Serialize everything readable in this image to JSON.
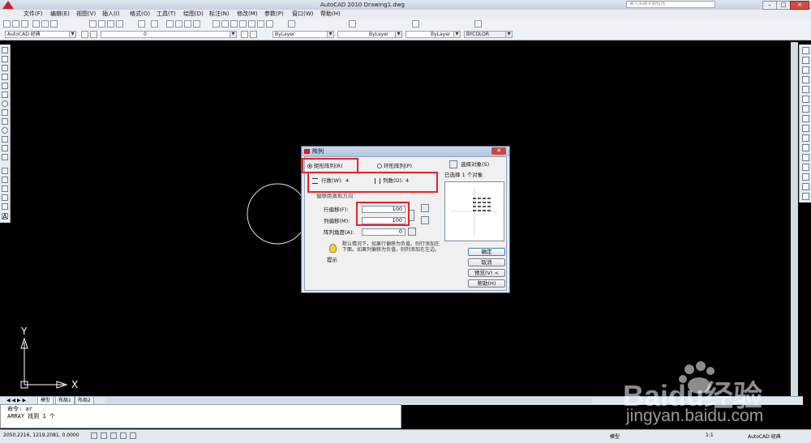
{
  "window": {
    "title": "AutoCAD 2010    Drawing1.dwg",
    "search_placeholder": "键入关键字或短语"
  },
  "menu": [
    "文件(F)",
    "编辑(E)",
    "视图(V)",
    "插入(I)",
    "格式(O)",
    "工具(T)",
    "绘图(D)",
    "标注(N)",
    "修改(M)",
    "参数(P)",
    "窗口(W)",
    "帮助(H)"
  ],
  "toolbar": {
    "workspace": "AutoCAD 经典",
    "layer": "0",
    "color": "ByLayer",
    "linetype": "ByLayer",
    "lineweight": "ByLayer",
    "plotstyle": "BYCOLOR"
  },
  "dialog": {
    "title": "阵列",
    "rect_array": "矩形阵列(R)",
    "polar_array": "环形阵列(P)",
    "select_objects": "选择对象(S)",
    "selected_count": "已选择 1 个对象",
    "rows_label": "行数(W):",
    "rows_value": "4",
    "cols_label": "列数(O):",
    "cols_value": "4",
    "offset_section": "偏移距离和方向",
    "row_offset_label": "行偏移(F):",
    "row_offset_value": "100",
    "col_offset_label": "列偏移(M):",
    "col_offset_value": "100",
    "angle_label": "阵列角度(A):",
    "angle_value": "0",
    "tip_text": "默认情况下，如果行偏移为负值，则行添加在下面。如果列偏移为负值，则列添加在左边。",
    "tip_label": "提示",
    "ok": "确定",
    "cancel": "取消",
    "preview": "预览(V) <",
    "help": "帮助(H)"
  },
  "ucs": {
    "x": "X",
    "y": "Y"
  },
  "tabs": [
    "模型",
    "布局1",
    "布局2"
  ],
  "command": {
    "line1": "命令: ar",
    "line2": "ARRAY 找到 1 个"
  },
  "status": {
    "coords": "2050.2216, 1219.2081, 0.0000",
    "model": "模型",
    "scale": "1:1",
    "workspace_status": "AutoCAD 经典"
  },
  "watermark": {
    "brand": "Baidu经验",
    "url": "jingyan.baidu.com"
  },
  "colors": {
    "canvas": "#000000",
    "highlight": "#e8222a",
    "ok_focus": "#3c7fb1"
  }
}
